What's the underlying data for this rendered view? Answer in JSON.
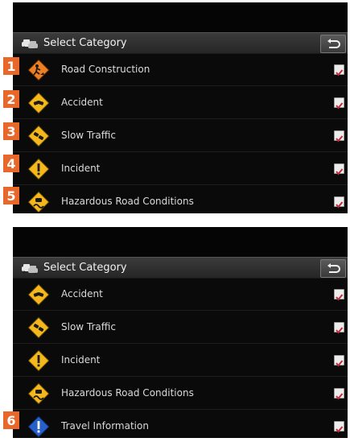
{
  "screens": [
    {
      "header_title": "Select Category",
      "rows": [
        {
          "label": "Road Construction",
          "icon": "road-construction-icon",
          "checked": true
        },
        {
          "label": "Accident",
          "icon": "accident-icon",
          "checked": true
        },
        {
          "label": "Slow Traffic",
          "icon": "slow-traffic-icon",
          "checked": true
        },
        {
          "label": "Incident",
          "icon": "incident-icon",
          "checked": true
        },
        {
          "label": "Hazardous Road Conditions",
          "icon": "hazardous-road-icon",
          "checked": true
        }
      ]
    },
    {
      "header_title": "Select Category",
      "rows": [
        {
          "label": "Accident",
          "icon": "accident-icon",
          "checked": true
        },
        {
          "label": "Slow Traffic",
          "icon": "slow-traffic-icon",
          "checked": true
        },
        {
          "label": "Incident",
          "icon": "incident-icon",
          "checked": true
        },
        {
          "label": "Hazardous Road Conditions",
          "icon": "hazardous-road-icon",
          "checked": true
        },
        {
          "label": "Travel Information",
          "icon": "travel-information-icon",
          "checked": true
        }
      ]
    }
  ],
  "callouts": [
    "1",
    "2",
    "3",
    "4",
    "5",
    "6"
  ],
  "colors": {
    "callout": "#e8672b",
    "warning_sign": "#f4b81c",
    "construction_sign": "#ee7f22",
    "info_sign": "#2660c8",
    "check": "#c22c3a"
  }
}
